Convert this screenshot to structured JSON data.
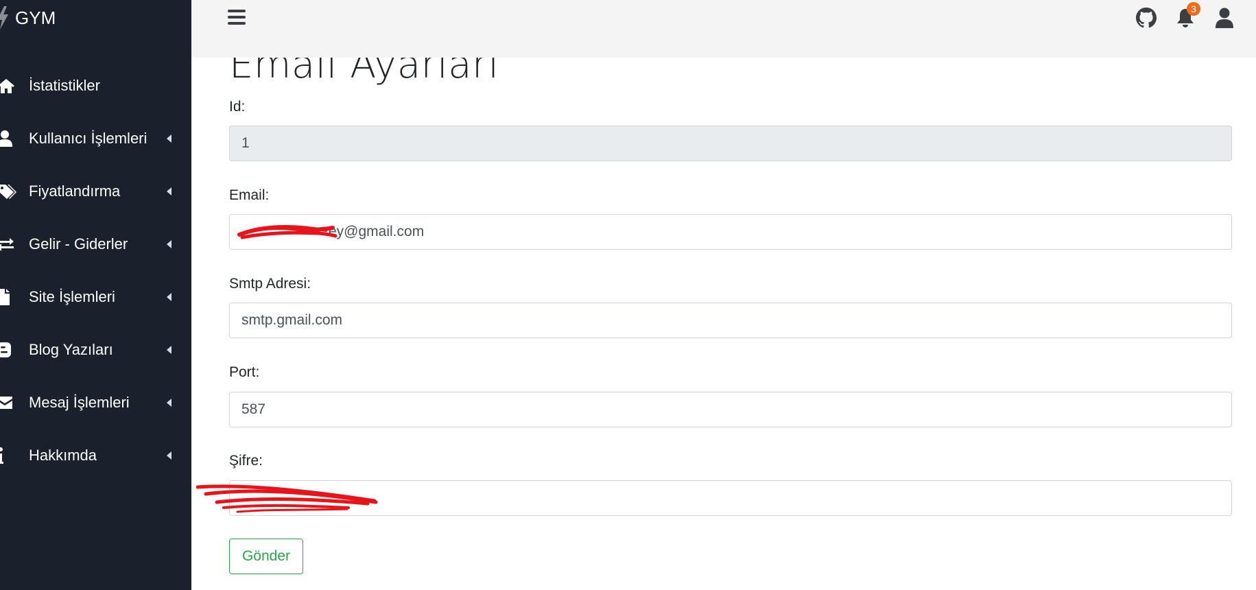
{
  "brand": {
    "name": "GYM",
    "icon": "bolt-icon"
  },
  "sidebar": {
    "items": [
      {
        "label": "İstatistikler",
        "icon": "home-icon",
        "has_submenu": false
      },
      {
        "label": "Kullanıcı İşlemleri",
        "icon": "user-icon",
        "has_submenu": true
      },
      {
        "label": "Fiyatlandırma",
        "icon": "tags-icon",
        "has_submenu": true
      },
      {
        "label": "Gelir - Giderler",
        "icon": "exchange-icon",
        "has_submenu": true
      },
      {
        "label": "Site İşlemleri",
        "icon": "file-icon",
        "has_submenu": true
      },
      {
        "label": "Blog Yazıları",
        "icon": "blogger-icon",
        "has_submenu": true
      },
      {
        "label": "Mesaj İşlemleri",
        "icon": "envelope-icon",
        "has_submenu": true
      },
      {
        "label": "Hakkımda",
        "icon": "info-icon",
        "has_submenu": true
      }
    ]
  },
  "topbar": {
    "menu_icon": "hamburger-icon",
    "github_icon": "github-icon",
    "notifications": {
      "icon": "bell-icon",
      "count": "3"
    },
    "user_icon": "user-icon"
  },
  "page": {
    "title": "Email Ayarları",
    "fields": {
      "id": {
        "label": "Id:",
        "value": "1"
      },
      "email": {
        "label": "Email:",
        "value": "ey@gmail.com"
      },
      "smtp": {
        "label": "Smtp Adresi:",
        "value": "smtp.gmail.com"
      },
      "port": {
        "label": "Port:",
        "value": "587"
      },
      "password": {
        "label": "Şifre:",
        "value": ""
      }
    },
    "submit_label": "Gönder"
  },
  "colors": {
    "sidebar_bg": "#1a212d",
    "topbar_bg": "#f4f4f4",
    "badge": "#f26b16",
    "success": "#28a745",
    "redaction": "#e8141a"
  }
}
